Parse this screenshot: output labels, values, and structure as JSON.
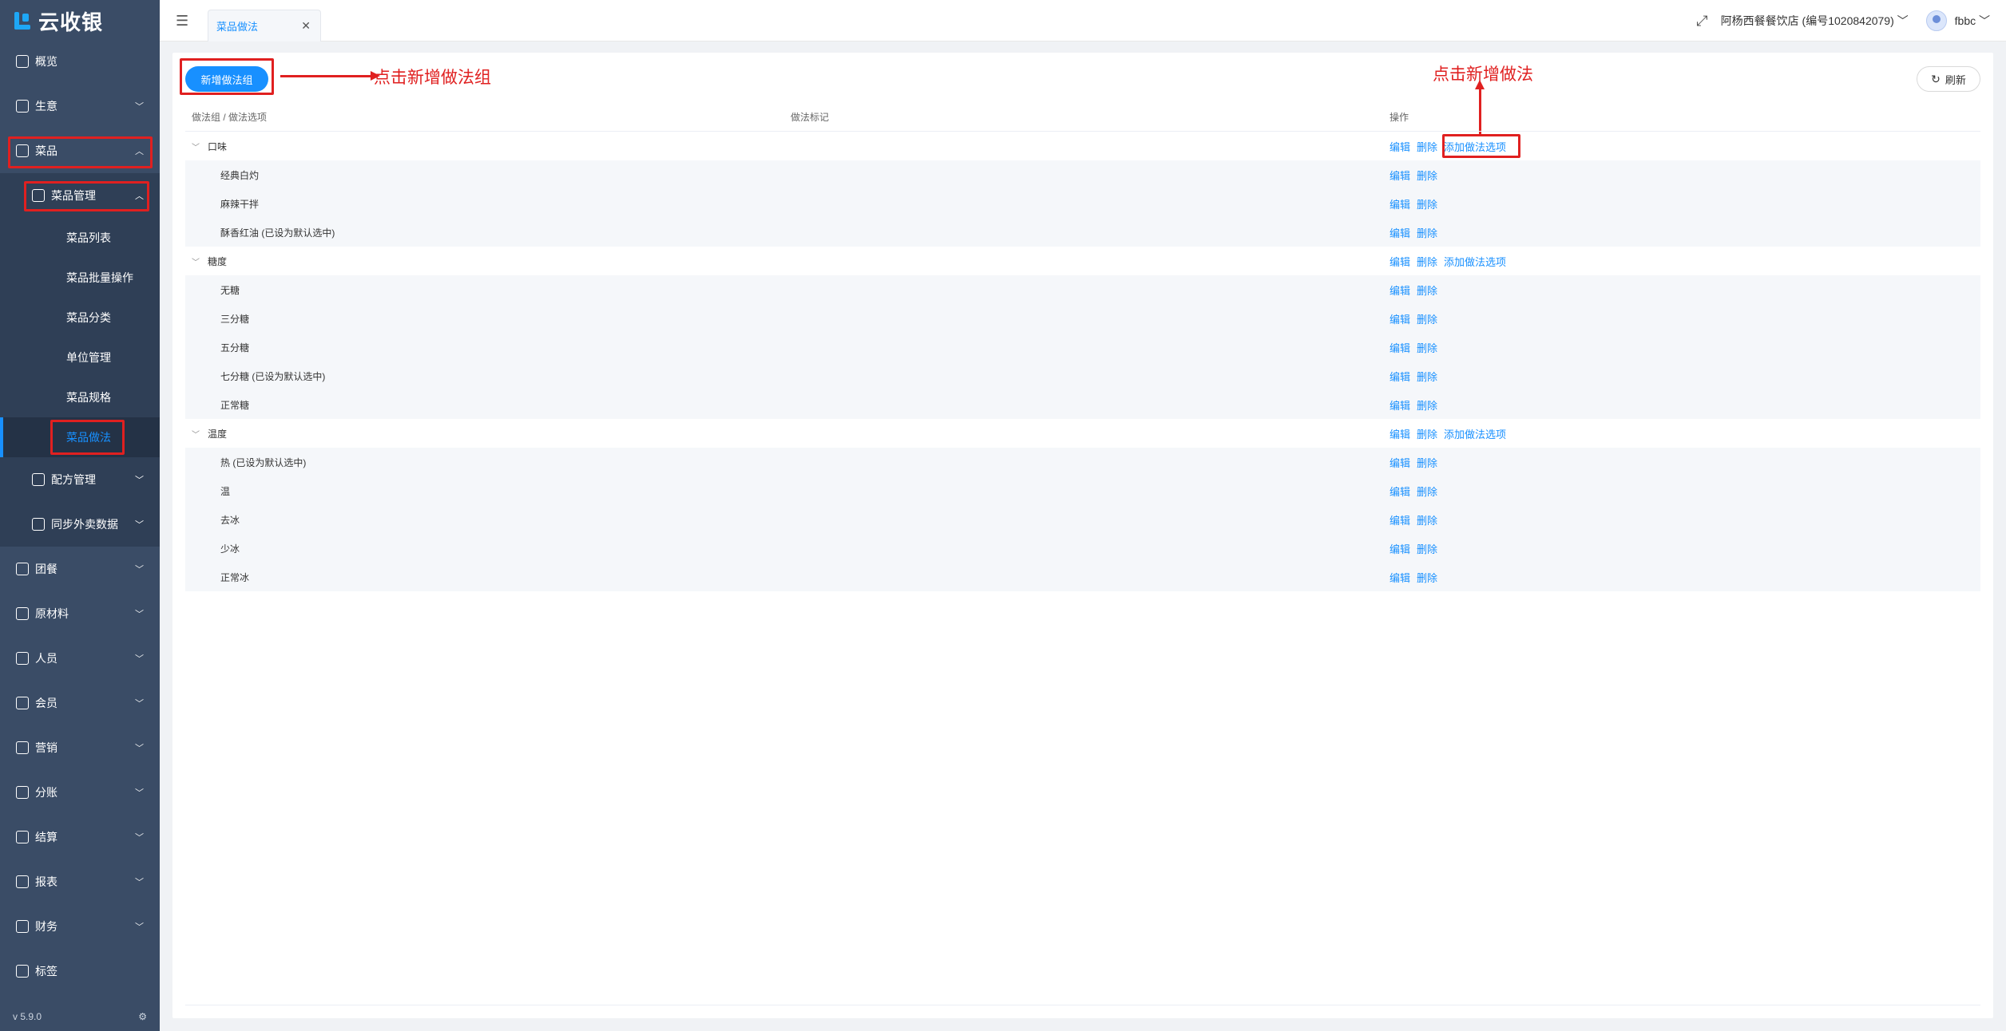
{
  "app": {
    "name": "云收银",
    "version": "v 5.9.0"
  },
  "sidebar": {
    "top_items": [
      {
        "label": "概览"
      },
      {
        "label": "生意"
      },
      {
        "label": "菜品"
      }
    ],
    "sub_group": {
      "label": "菜品管理"
    },
    "sub_items": [
      {
        "label": "菜品列表"
      },
      {
        "label": "菜品批量操作"
      },
      {
        "label": "菜品分类"
      },
      {
        "label": "单位管理"
      },
      {
        "label": "菜品规格"
      },
      {
        "label": "菜品做法"
      }
    ],
    "sub_groups_more": [
      {
        "label": "配方管理"
      },
      {
        "label": "同步外卖数据"
      }
    ],
    "bottom_items": [
      {
        "label": "团餐"
      },
      {
        "label": "原材料"
      },
      {
        "label": "人员"
      },
      {
        "label": "会员"
      },
      {
        "label": "营销"
      },
      {
        "label": "分账"
      },
      {
        "label": "结算"
      },
      {
        "label": "报表"
      },
      {
        "label": "财务"
      },
      {
        "label": "标签"
      }
    ]
  },
  "header": {
    "tab_label": "菜品做法",
    "store": "阿杨西餐餐饮店 (编号1020842079)",
    "user": "fbbc"
  },
  "toolbar": {
    "add_group_label": "新增做法组",
    "refresh_label": "刷新"
  },
  "annotations": {
    "add_group_hint": "点击新增做法组",
    "add_option_hint": "点击新增做法"
  },
  "table": {
    "headers": [
      "做法组 / 做法选项",
      "做法标记",
      "操作"
    ],
    "actions": {
      "edit": "编辑",
      "delete": "删除",
      "add_option": "添加做法选项"
    },
    "groups": [
      {
        "name": "口味",
        "options": [
          "经典白灼",
          "麻辣干拌",
          "酥香红油 (已设为默认选中)"
        ]
      },
      {
        "name": "糖度",
        "options": [
          "无糖",
          "三分糖",
          "五分糖",
          "七分糖 (已设为默认选中)",
          "正常糖"
        ]
      },
      {
        "name": "温度",
        "options": [
          "热 (已设为默认选中)",
          "温",
          "去冰",
          "少冰",
          "正常冰"
        ]
      }
    ]
  }
}
